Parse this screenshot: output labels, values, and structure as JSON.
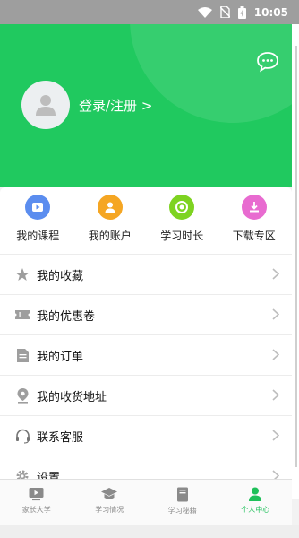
{
  "status_bar": {
    "time": "10:05"
  },
  "header": {
    "login_label": "登录/注册 >",
    "background": "#20c95f"
  },
  "quick_actions": [
    {
      "label": "我的课程",
      "icon": "play-icon",
      "color": "#5b8def"
    },
    {
      "label": "我的账户",
      "icon": "person-icon",
      "color": "#f5a623"
    },
    {
      "label": "学习时长",
      "icon": "timer-icon",
      "color": "#7ed321"
    },
    {
      "label": "下载专区",
      "icon": "download-icon",
      "color": "#e86bd0"
    }
  ],
  "menu": [
    {
      "label": "我的收藏",
      "icon": "star-icon"
    },
    {
      "label": "我的优惠卷",
      "icon": "ticket-icon"
    },
    {
      "label": "我的订单",
      "icon": "order-icon"
    },
    {
      "label": "我的收货地址",
      "icon": "location-icon"
    },
    {
      "label": "联系客服",
      "icon": "headset-icon"
    },
    {
      "label": "设置",
      "icon": "gear-icon"
    }
  ],
  "bottom_nav": [
    {
      "label": "家长大学",
      "icon": "video-icon",
      "active": false
    },
    {
      "label": "学习情况",
      "icon": "graduation-cap-icon",
      "active": false
    },
    {
      "label": "学习秘籍",
      "icon": "book-icon",
      "active": false
    },
    {
      "label": "个人中心",
      "icon": "user-icon",
      "active": true
    }
  ],
  "accent_color": "#1fc05a"
}
